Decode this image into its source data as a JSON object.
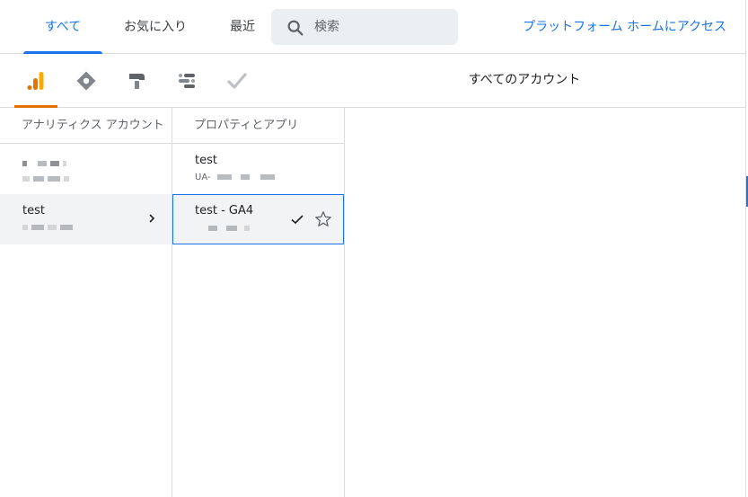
{
  "tabs": [
    {
      "label": "すべて",
      "active": true
    },
    {
      "label": "お気に入り",
      "active": false
    },
    {
      "label": "最近",
      "active": false
    }
  ],
  "search": {
    "placeholder": "検索",
    "icon": "search-icon"
  },
  "platform_link": "プラットフォーム ホームにアクセス",
  "products": [
    {
      "name": "analytics",
      "icon": "analytics-icon",
      "active": true
    },
    {
      "name": "tag-manager",
      "icon": "tag-manager-icon",
      "active": false
    },
    {
      "name": "optimize",
      "icon": "optimize-icon",
      "active": false
    },
    {
      "name": "data-studio",
      "icon": "data-studio-icon",
      "active": false
    },
    {
      "name": "surveys",
      "icon": "surveys-icon",
      "active": false
    }
  ],
  "product_title": "すべてのアカウント",
  "accounts_column": {
    "header": "アナリティクス アカウント",
    "items": [
      {
        "name": "",
        "sub": "",
        "blurred": true,
        "selected": false
      },
      {
        "name": "test",
        "sub": "",
        "blurred_sub": true,
        "selected": true
      }
    ]
  },
  "properties_column": {
    "header": "プロパティとアプリ",
    "items": [
      {
        "name": "test",
        "sub": "UA-",
        "selected": false
      },
      {
        "name": "test - GA4",
        "sub": "",
        "selected": true
      }
    ]
  },
  "colors": {
    "accent": "#1a73e8",
    "analytics_orange": "#e37400",
    "divider": "#dadce0"
  }
}
